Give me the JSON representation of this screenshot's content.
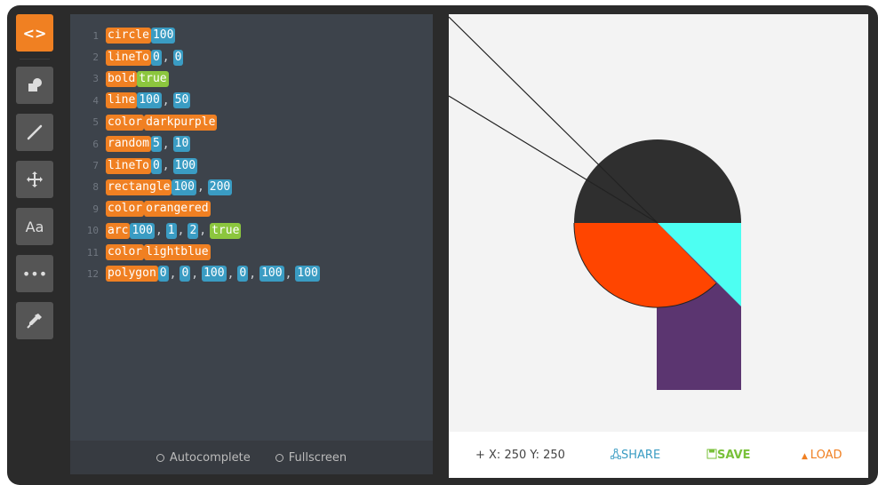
{
  "toolbar": {
    "code_label": "<>",
    "font_label": "Aa",
    "more_label": "•••"
  },
  "code": [
    {
      "n": "1",
      "tokens": [
        {
          "t": "circle",
          "k": "kw"
        },
        {
          "t": "100",
          "k": "num"
        }
      ]
    },
    {
      "n": "2",
      "tokens": [
        {
          "t": "lineTo",
          "k": "kw"
        },
        {
          "t": "0",
          "k": "num"
        },
        {
          "t": "0",
          "k": "num"
        }
      ]
    },
    {
      "n": "3",
      "tokens": [
        {
          "t": "bold",
          "k": "kw"
        },
        {
          "t": "true",
          "k": "bool"
        }
      ]
    },
    {
      "n": "4",
      "tokens": [
        {
          "t": "line",
          "k": "kw"
        },
        {
          "t": "100",
          "k": "num"
        },
        {
          "t": "50",
          "k": "num"
        }
      ]
    },
    {
      "n": "5",
      "tokens": [
        {
          "t": "color",
          "k": "kw"
        },
        {
          "t": "darkpurple",
          "k": "kw"
        }
      ]
    },
    {
      "n": "6",
      "tokens": [
        {
          "t": "random",
          "k": "kw"
        },
        {
          "t": "5",
          "k": "num"
        },
        {
          "t": "10",
          "k": "num"
        }
      ]
    },
    {
      "n": "7",
      "tokens": [
        {
          "t": "lineTo",
          "k": "kw"
        },
        {
          "t": "0",
          "k": "num"
        },
        {
          "t": "100",
          "k": "num"
        }
      ]
    },
    {
      "n": "8",
      "tokens": [
        {
          "t": "rectangle",
          "k": "kw"
        },
        {
          "t": "100",
          "k": "num"
        },
        {
          "t": "200",
          "k": "num"
        }
      ]
    },
    {
      "n": "9",
      "tokens": [
        {
          "t": "color",
          "k": "kw"
        },
        {
          "t": "orangered",
          "k": "kw"
        }
      ]
    },
    {
      "n": "10",
      "tokens": [
        {
          "t": "arc",
          "k": "kw"
        },
        {
          "t": "100",
          "k": "num"
        },
        {
          "t": "1",
          "k": "num"
        },
        {
          "t": "2",
          "k": "num"
        },
        {
          "t": "true",
          "k": "bool"
        }
      ]
    },
    {
      "n": "11",
      "tokens": [
        {
          "t": "color",
          "k": "kw"
        },
        {
          "t": "lightblue",
          "k": "kw"
        }
      ]
    },
    {
      "n": "12",
      "tokens": [
        {
          "t": "polygon",
          "k": "kw"
        },
        {
          "t": "0",
          "k": "num"
        },
        {
          "t": "0",
          "k": "num"
        },
        {
          "t": "100",
          "k": "num"
        },
        {
          "t": "0",
          "k": "num"
        },
        {
          "t": "100",
          "k": "num"
        },
        {
          "t": "100",
          "k": "num"
        }
      ]
    }
  ],
  "editor_footer": {
    "autocomplete_label": "Autocomplete",
    "fullscreen_label": "Fullscreen"
  },
  "status": {
    "coords_label": "+ X: 250 Y: 250",
    "share_label": "SHARE",
    "save_label": "SAVE",
    "load_label": "LOAD"
  },
  "colors": {
    "accent": "#f08022",
    "number": "#3a9cc3",
    "boolean": "#8cc63e",
    "circle_fill": "#2f2f2f",
    "rectangle_fill": "#5b3570",
    "arc_fill": "#ff4500",
    "polygon_fill": "#4dfff2"
  }
}
